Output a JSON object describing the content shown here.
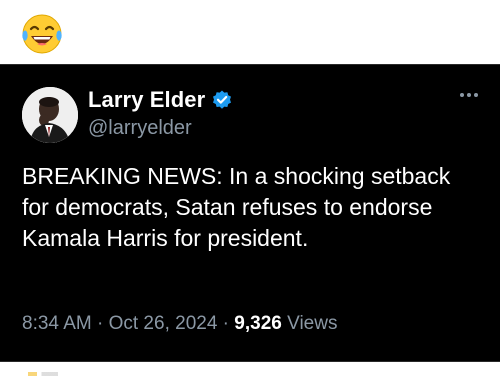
{
  "caption": {
    "emoji_icon": "face-with-tears-of-joy-icon"
  },
  "tweet": {
    "author": {
      "display_name": "Larry Elder",
      "handle": "@larryelder",
      "verified_icon": "verified-badge-icon",
      "avatar_icon": "profile-avatar"
    },
    "more_icon": "more-options-icon",
    "text": "BREAKING NEWS: In a shocking setback for democrats, Satan refuses to endorse Kamala Harris for president.",
    "timestamp": "8:34 AM · Oct 26, 2024",
    "separator": "·",
    "views_count": "9,326",
    "views_label": "Views"
  },
  "colors": {
    "card_background": "#000000",
    "text_primary": "#ffffff",
    "text_secondary": "#8b98a5",
    "verified_blue": "#1d9bf0",
    "page_background": "#ffffff"
  }
}
